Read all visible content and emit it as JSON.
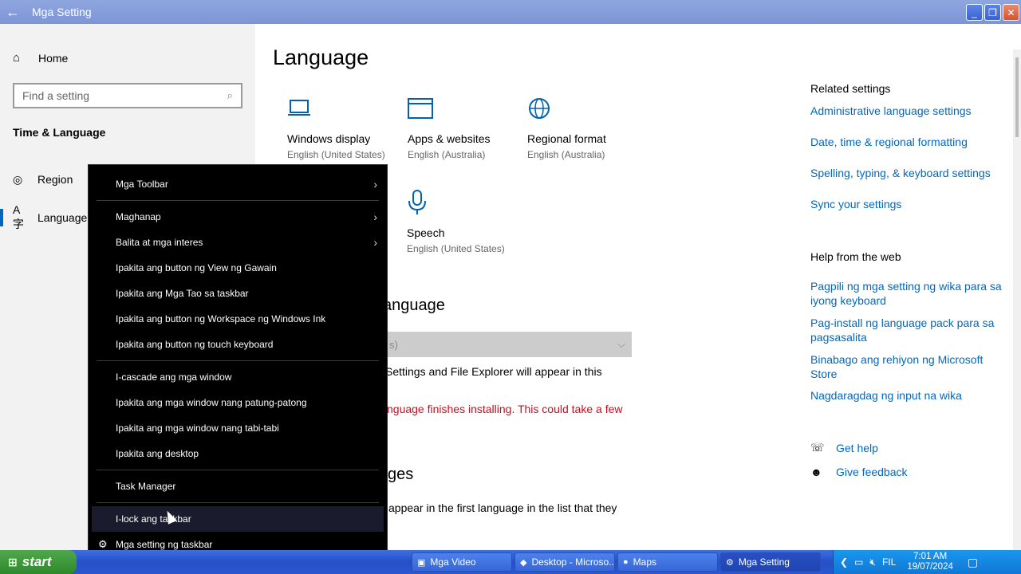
{
  "window": {
    "title": "Mga Setting",
    "back_glyph": "←",
    "min": "_",
    "max": "❐",
    "close": "✕"
  },
  "sidebar": {
    "home_label": "Home",
    "search_placeholder": "Find a setting",
    "section_title": "Time & Language",
    "items": [
      {
        "label": "Region"
      },
      {
        "label": "Language",
        "active": true
      }
    ]
  },
  "main": {
    "title": "Language",
    "tiles": [
      {
        "name": "Windows display",
        "sub": "English (United States)"
      },
      {
        "name": "Apps & websites",
        "sub": "English (Australia)"
      },
      {
        "name": "Regional format",
        "sub": "English (Australia)"
      },
      {
        "name": "Speech",
        "sub": "English (United States)"
      }
    ],
    "display_language_heading": "y language",
    "dropdown_value": "s)",
    "dropdown_chevron": "⌵",
    "display_text": "Settings and File Explorer will appear in this",
    "warning_text": "nguage finishes installing. This could take a few",
    "languages_heading": "ges",
    "languages_text": "appear in the first language in the list that they"
  },
  "related": {
    "heading": "Related settings",
    "links": [
      "Administrative language settings",
      "Date, time & regional formatting",
      "Spelling, typing, & keyboard settings",
      "Sync your settings"
    ],
    "help_heading": "Help from the web",
    "help_links": [
      "Pagpili ng mga setting ng wika para sa iyong keyboard",
      "Pag-install ng language pack para sa pagsasalita",
      "Binabago ang rehiyon ng Microsoft Store",
      "Nagdaragdag ng input na wika"
    ],
    "get_help": "Get help",
    "give_feedback": "Give feedback"
  },
  "context_menu": {
    "items": [
      {
        "label": "Mga Toolbar",
        "submenu": true
      },
      {
        "label": "Maghanap",
        "submenu": true
      },
      {
        "label": "Balita at mga interes",
        "submenu": true
      },
      {
        "label": "Ipakita ang button ng View ng Gawain"
      },
      {
        "label": "Ipakita ang Mga Tao sa taskbar"
      },
      {
        "label": "Ipakita ang button ng Workspace ng Windows Ink"
      },
      {
        "label": "Ipakita ang button ng touch keyboard"
      },
      {
        "label": "I-cascade ang mga window"
      },
      {
        "label": "Ipakita ang mga window nang patung-patong"
      },
      {
        "label": "Ipakita ang mga window nang tabi-tabi"
      },
      {
        "label": "Ipakita ang desktop"
      },
      {
        "label": "Task Manager"
      },
      {
        "label": "I-lock ang taskbar",
        "hover": true
      },
      {
        "label": "Mga setting ng taskbar",
        "icon": "gear-icon"
      }
    ],
    "arrow": "›"
  },
  "taskbar": {
    "start_label": "start",
    "buttons": [
      {
        "label": "Mga Video"
      },
      {
        "label": "Desktop - Microso..."
      },
      {
        "label": "Maps"
      },
      {
        "label": "Mga Setting",
        "active": true
      }
    ],
    "language": "FIL",
    "time": "7:01 AM",
    "date": "19/07/2024"
  }
}
